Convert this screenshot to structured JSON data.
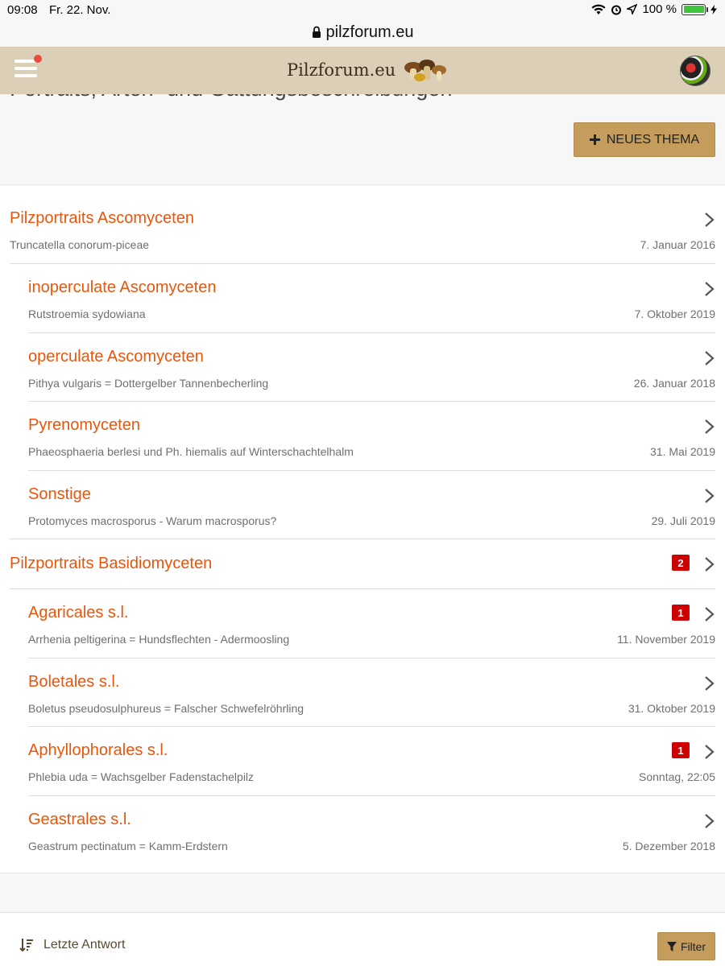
{
  "status": {
    "time": "09:08",
    "date": "Fr. 22. Nov.",
    "battery": "100 %"
  },
  "browser": {
    "url": "pilzforum.eu"
  },
  "header": {
    "logo_text": "Pilzforum.eu",
    "menu_icon": "hamburger-icon",
    "avatar_icon": "user-avatar"
  },
  "board": {
    "title": "Portraits, Arten- und Gattungsbeschreibungen",
    "new_thread_label": "NEUES THEMA"
  },
  "forums": [
    {
      "name": "Pilzportraits Ascomyceten",
      "last": "Truncatella conorum-piceae",
      "date": "7. Januar 2016",
      "badge": ""
    },
    {
      "name": "inoperculate Ascomyceten",
      "last": "Rutstroemia sydowiana",
      "date": "7. Oktober 2019",
      "badge": ""
    },
    {
      "name": "operculate Ascomyceten",
      "last": "Pithya vulgaris = Dottergelber Tannenbecherling",
      "date": "26. Januar 2018",
      "badge": ""
    },
    {
      "name": "Pyrenomyceten",
      "last": "Phaeosphaeria berlesi und Ph. hiemalis auf Winterschachtelhalm",
      "date": "31. Mai 2019",
      "badge": ""
    },
    {
      "name": "Sonstige",
      "last": "Protomyces macrosporus - Warum macrosporus?",
      "date": "29. Juli 2019",
      "badge": ""
    },
    {
      "name": "Pilzportraits Basidiomyceten",
      "last": "",
      "date": "",
      "badge": "2"
    },
    {
      "name": "Agaricales s.l.",
      "last": "Arrhenia peltigerina = Hundsflechten - Adermoosling",
      "date": "11. November 2019",
      "badge": "1"
    },
    {
      "name": "Boletales s.l.",
      "last": "Boletus pseudosulphureus = Falscher Schwefelröhrling",
      "date": "31. Oktober 2019",
      "badge": ""
    },
    {
      "name": "Aphyllophorales s.l.",
      "last": "Phlebia uda = Wachsgelber Fadenstachelpilz",
      "date": "Sonntag, 22:05",
      "badge": "1"
    },
    {
      "name": "Geastrales s.l.",
      "last": "Geastrum pectinatum = Kamm-Erdstern",
      "date": "5. Dezember 2018",
      "badge": ""
    }
  ],
  "bottom": {
    "sort_label": "Letzte Antwort",
    "filter_label": "Filter"
  },
  "colors": {
    "accent": "#e8560b",
    "header_bg": "#dccfb7",
    "button_bg": "#c49c5b",
    "badge_bg": "#cc0000"
  }
}
